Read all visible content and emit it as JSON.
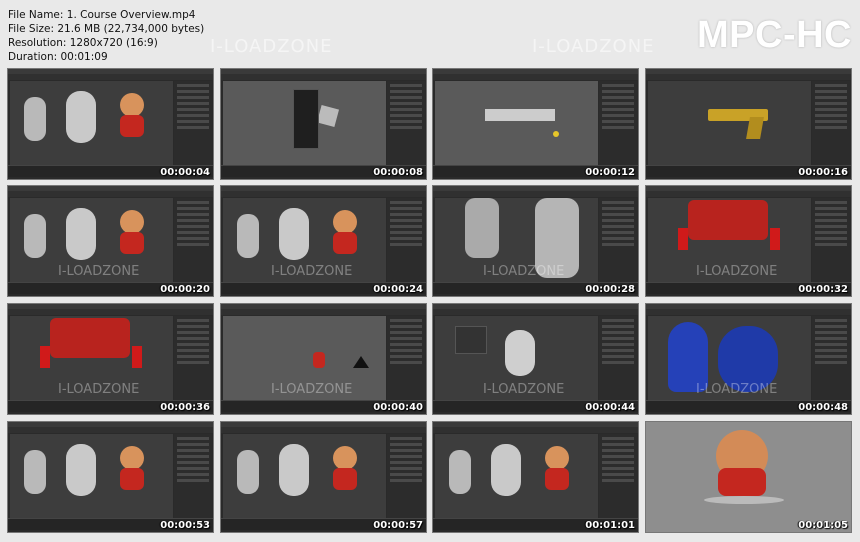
{
  "file_info": {
    "name": "File Name: 1. Course Overview.mp4",
    "size": "File Size: 21.6 MB (22,734,000 bytes)",
    "resolution": "Resolution: 1280x720 (16:9)",
    "duration": "Duration: 00:01:09"
  },
  "brand": "MPC-HC",
  "watermark": "I-LOADZONE",
  "thumbnails": [
    {
      "timestamp": "00:00:04",
      "scene": "characters-gray-red"
    },
    {
      "timestamp": "00:00:08",
      "scene": "cube-menu"
    },
    {
      "timestamp": "00:00:12",
      "scene": "plane-top"
    },
    {
      "timestamp": "00:00:16",
      "scene": "golden-gun"
    },
    {
      "timestamp": "00:00:20",
      "scene": "three-views"
    },
    {
      "timestamp": "00:00:24",
      "scene": "three-characters"
    },
    {
      "timestamp": "00:00:28",
      "scene": "leg-closeup"
    },
    {
      "timestamp": "00:00:32",
      "scene": "red-shirt-closeup"
    },
    {
      "timestamp": "00:00:36",
      "scene": "red-shirt-panels"
    },
    {
      "timestamp": "00:00:40",
      "scene": "small-character"
    },
    {
      "timestamp": "00:00:44",
      "scene": "gray-character-nodes"
    },
    {
      "timestamp": "00:00:48",
      "scene": "blue-rig"
    },
    {
      "timestamp": "00:00:53",
      "scene": "characters-gray-red-2"
    },
    {
      "timestamp": "00:00:57",
      "scene": "three-views-red"
    },
    {
      "timestamp": "00:01:01",
      "scene": "three-views-red-2"
    },
    {
      "timestamp": "00:01:05",
      "scene": "final-render"
    }
  ]
}
